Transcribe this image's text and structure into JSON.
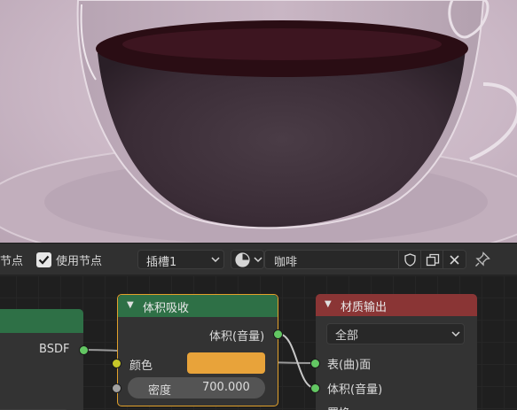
{
  "header": {
    "partial_label": "节点",
    "use_nodes_label": "使用节点",
    "slot_dropdown": "插槽1",
    "material_name": "咖啡"
  },
  "nodes": {
    "left": {
      "output_label": "BSDF"
    },
    "volume_absorption": {
      "title": "体积吸收",
      "output_label": "体积(音量)",
      "color_label": "颜色",
      "color_value": "#e8a33a",
      "density_label": "密度",
      "density_value": "700.000"
    },
    "material_output": {
      "title": "材质输出",
      "target_dropdown": "全部",
      "surface_label": "表(曲)面",
      "volume_label": "体积(音量)",
      "displacement_partial": "置换"
    }
  },
  "colors": {
    "node_header_green": "#2e7046",
    "node_header_red": "#8a3535",
    "selected_outline": "#e2a12b"
  }
}
